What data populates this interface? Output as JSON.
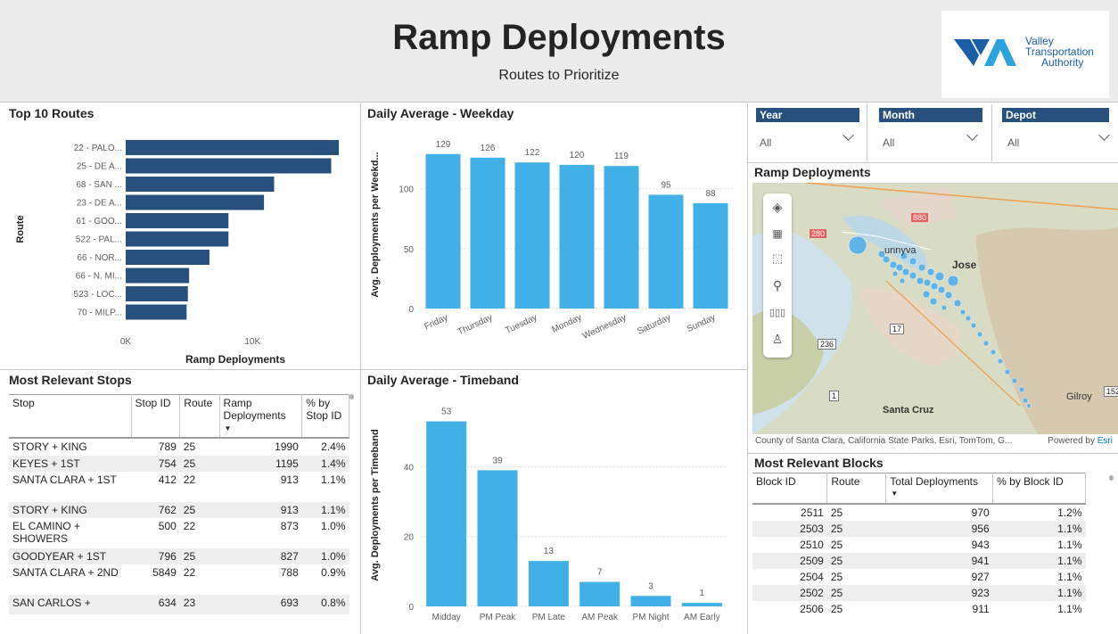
{
  "header": {
    "title": "Ramp Deployments",
    "subtitle": "Routes to Prioritize",
    "logo": {
      "line1": "Valley",
      "line2": "Transportation",
      "line3": "Authority",
      "colors": [
        "#1a5ea8",
        "#2aa3df"
      ]
    }
  },
  "top_routes": {
    "title": "Top 10 Routes",
    "ylabel": "Route",
    "xlabel": "Ramp Deployments",
    "ticks": [
      "0K",
      "10K"
    ],
    "color": "#27507f",
    "chart_data": {
      "type": "bar",
      "orientation": "horizontal",
      "categories": [
        "22 - PALO...",
        "25 - DE A...",
        "68 - SAN ...",
        "23 - DE A...",
        "61 - GOO...",
        "522 - PAL...",
        "66 - NOR...",
        "66 - N. MI...",
        "523 - LOC...",
        "70 - MILP..."
      ],
      "values": [
        16800,
        16200,
        11700,
        10900,
        8100,
        8100,
        6600,
        5000,
        4900,
        4800
      ],
      "xlim": [
        0,
        17500
      ]
    }
  },
  "weekday": {
    "title": "Daily Average - Weekday",
    "ylabel": "Avg. Deployments per Weekd...",
    "color": "#41b0e6",
    "chart_data": {
      "type": "bar",
      "categories": [
        "Friday",
        "Thursday",
        "Tuesday",
        "Monday",
        "Wednesday",
        "Saturday",
        "Sunday"
      ],
      "values": [
        129,
        126,
        122,
        120,
        119,
        95,
        88
      ],
      "yticks": [
        0,
        50,
        100
      ],
      "ylim": [
        0,
        140
      ]
    }
  },
  "timeband": {
    "title": "Daily Average - Timeband",
    "ylabel": "Avg. Deployments per Timeband",
    "color": "#41b0e6",
    "chart_data": {
      "type": "bar",
      "categories": [
        "Midday",
        "PM Peak",
        "PM Late",
        "AM Peak",
        "PM Night",
        "AM Early"
      ],
      "values": [
        53,
        39,
        13,
        7,
        3,
        1
      ],
      "yticks": [
        0,
        20,
        40
      ],
      "ylim": [
        0,
        58
      ]
    }
  },
  "stops_table": {
    "title": "Most Relevant Stops",
    "columns": [
      "Stop",
      "Stop ID",
      "Route",
      "Ramp Deployments",
      "% by Stop ID"
    ],
    "rows": [
      [
        "STORY + KING",
        "789",
        "25",
        "1990",
        "2.4%"
      ],
      [
        "KEYES + 1ST",
        "754",
        "25",
        "1195",
        "1.4%"
      ],
      [
        "SANTA CLARA + 1ST",
        "412",
        "22",
        "913",
        "1.1%"
      ],
      [
        "STORY + KING",
        "762",
        "25",
        "913",
        "1.1%"
      ],
      [
        "EL CAMINO + SHOWERS",
        "500",
        "22",
        "873",
        "1.0%"
      ],
      [
        "GOODYEAR + 1ST",
        "796",
        "25",
        "827",
        "1.0%"
      ],
      [
        "SANTA CLARA + 2ND",
        "5849",
        "22",
        "788",
        "0.9%"
      ],
      [
        "SAN CARLOS +",
        "634",
        "23",
        "693",
        "0.8%"
      ]
    ]
  },
  "slicers": [
    {
      "label": "Year",
      "value": "All"
    },
    {
      "label": "Month",
      "value": "All"
    },
    {
      "label": "Depot",
      "value": "All"
    }
  ],
  "map": {
    "title": "Ramp Deployments",
    "attribution": "County of Santa Clara, California State Parks, Esri, TomTom, G...",
    "powered_by": "Powered by",
    "powered_brand": "Esri",
    "labels": [
      "unnyva",
      "Jose",
      "Santa Cruz",
      "Gilroy",
      "236",
      "17",
      "1",
      "280",
      "880",
      "152"
    ],
    "tools": [
      "layers-icon",
      "qr-select-icon",
      "rect-select-icon",
      "search-icon",
      "bar-legend-icon",
      "person-icon"
    ]
  },
  "blocks_table": {
    "title": "Most Relevant Blocks",
    "columns": [
      "Block ID",
      "Route",
      "Total Deployments",
      "% by Block ID"
    ],
    "rows": [
      [
        "2511",
        "25",
        "970",
        "1.2%"
      ],
      [
        "2503",
        "25",
        "956",
        "1.1%"
      ],
      [
        "2510",
        "25",
        "943",
        "1.1%"
      ],
      [
        "2509",
        "25",
        "941",
        "1.1%"
      ],
      [
        "2504",
        "25",
        "927",
        "1.1%"
      ],
      [
        "2502",
        "25",
        "923",
        "1.1%"
      ],
      [
        "2506",
        "25",
        "911",
        "1.1%"
      ]
    ]
  }
}
